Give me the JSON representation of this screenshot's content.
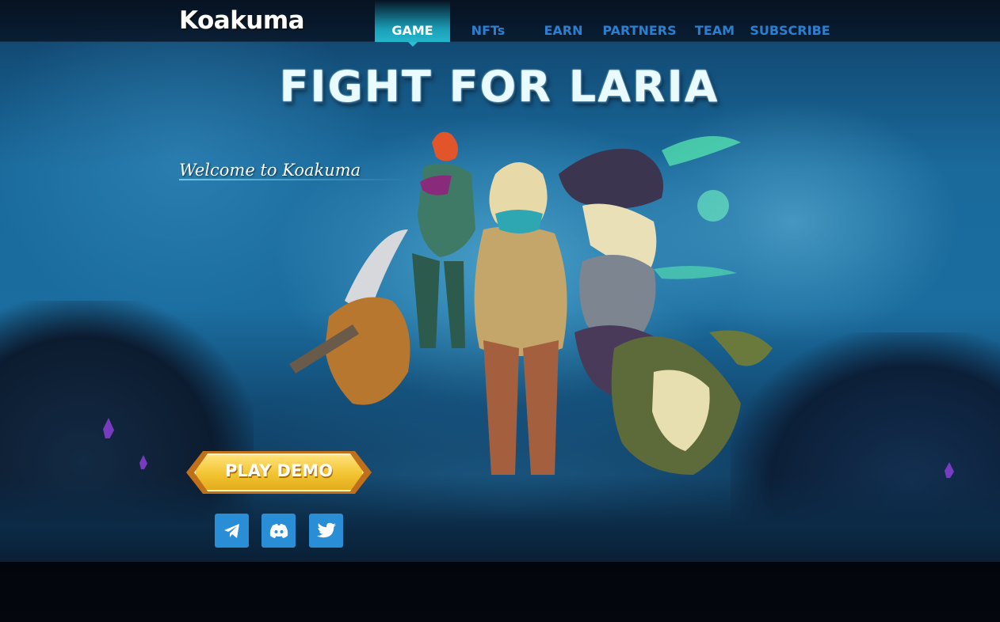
{
  "brand": {
    "logo_text": "Koakuma"
  },
  "nav": {
    "items": [
      {
        "label": "GAME",
        "active": true
      },
      {
        "label": "NFTs",
        "active": false
      },
      {
        "label": "EARN",
        "active": false
      },
      {
        "label": "PARTNERS",
        "active": false
      },
      {
        "label": "TEAM",
        "active": false
      },
      {
        "label": "SUBSCRIBE",
        "active": false
      }
    ]
  },
  "hero": {
    "headline": "FIGHT FOR LARIA",
    "welcome": "Welcome to Koakuma",
    "play_button": "PLAY DEMO"
  },
  "social": [
    {
      "icon": "telegram-icon"
    },
    {
      "icon": "discord-icon"
    },
    {
      "icon": "twitter-icon"
    }
  ],
  "colors": {
    "nav_link": "#2b7fd1",
    "nav_active_bg": "#1aa0b8",
    "button_gold": "#f2c431",
    "button_border": "#c0701a",
    "social_bg": "#2a8ed6"
  }
}
